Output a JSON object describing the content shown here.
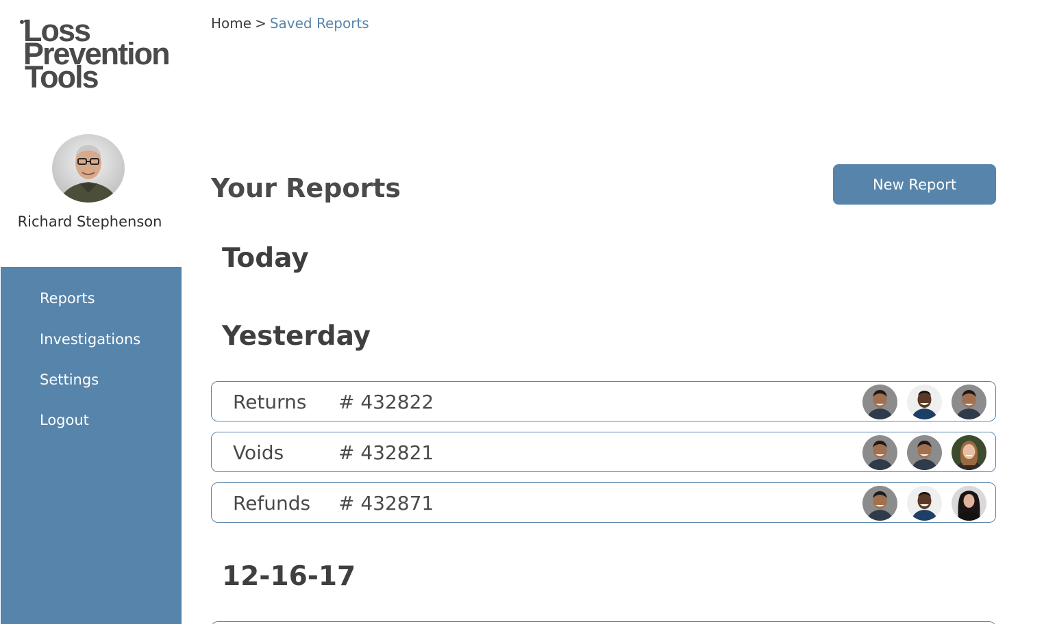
{
  "brand": {
    "logo_line1": "Loss",
    "logo_line2": "Prevention",
    "logo_line3": "Tools"
  },
  "user": {
    "name": "Richard Stephenson",
    "avatar": "user-photo"
  },
  "sidebar": {
    "background": "#5784aa",
    "items": [
      {
        "label": "Reports"
      },
      {
        "label": "Investigations"
      },
      {
        "label": "Settings"
      },
      {
        "label": "Logout"
      }
    ]
  },
  "breadcrumb": {
    "home": "Home",
    "separator": ">",
    "current": "Saved Reports"
  },
  "main": {
    "title": "Your Reports",
    "new_report_label": "New Report",
    "groups": [
      {
        "heading": "Today",
        "reports": []
      },
      {
        "heading": "Yesterday",
        "reports": [
          {
            "type": "Returns",
            "number": "# 432822",
            "assignees": [
              "person-a",
              "person-b",
              "person-a"
            ]
          },
          {
            "type": "Voids",
            "number": "# 432821",
            "assignees": [
              "person-a",
              "person-a",
              "person-c"
            ]
          },
          {
            "type": "Refunds",
            "number": "# 432871",
            "assignees": [
              "person-a",
              "person-b",
              "person-d"
            ]
          }
        ]
      },
      {
        "heading": "12-16-17",
        "reports": []
      }
    ]
  },
  "colors": {
    "accent": "#5784aa",
    "text": "#3f3f3f",
    "link": "#5784aa"
  }
}
